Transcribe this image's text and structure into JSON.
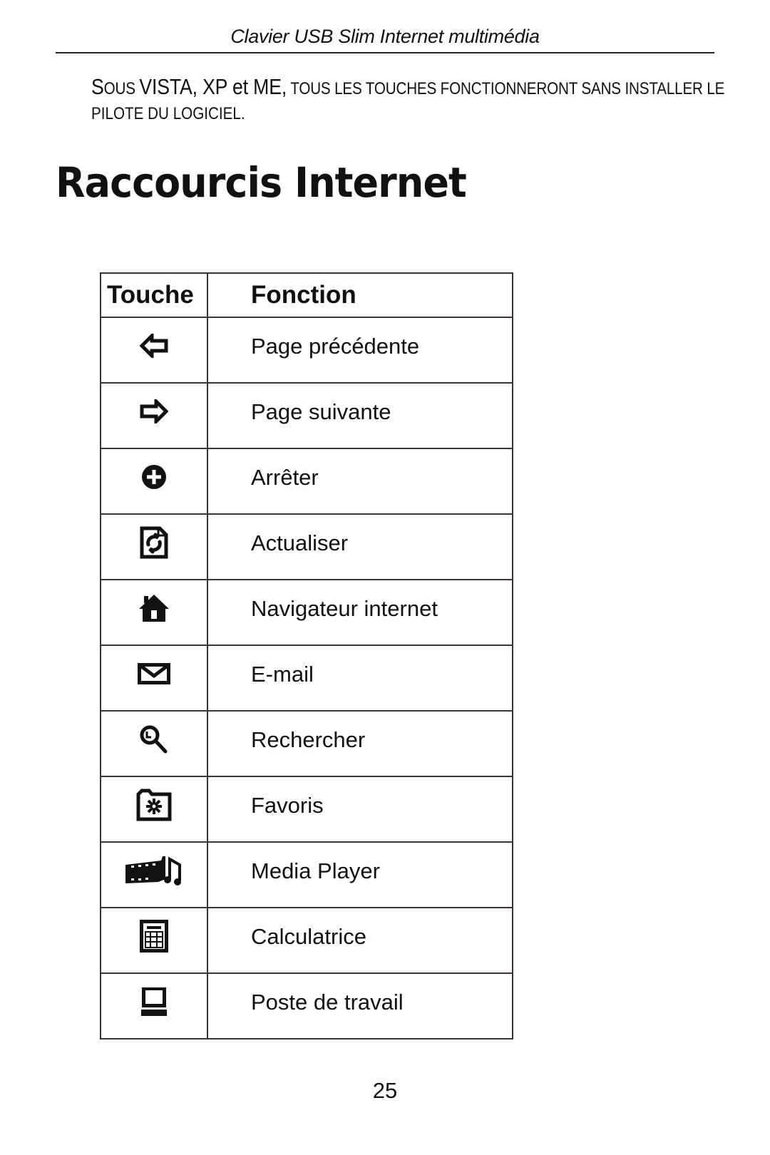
{
  "header": {
    "running_title": "Clavier USB Slim Internet multimédia"
  },
  "note": {
    "lead_1": "S",
    "lead_1_rest": "OUS",
    "lead_2": "VISTA, XP et ME,",
    "line1_rest": "TOUS LES TOUCHES FONCTIONNERONT SANS INSTALLER LE",
    "line2": "PILOTE DU LOGICIEL."
  },
  "section": {
    "title": "Raccourcis Internet"
  },
  "table": {
    "headers": {
      "key": "Touche",
      "function": "Fonction"
    },
    "rows": [
      {
        "icon": "back-arrow-icon",
        "function": "Page précédente"
      },
      {
        "icon": "forward-arrow-icon",
        "function": "Page suivante"
      },
      {
        "icon": "stop-icon",
        "function": "Arrêter"
      },
      {
        "icon": "refresh-icon",
        "function": "Actualiser"
      },
      {
        "icon": "home-icon",
        "function": "Navigateur internet"
      },
      {
        "icon": "mail-icon",
        "function": "E-mail"
      },
      {
        "icon": "search-icon",
        "function": "Rechercher"
      },
      {
        "icon": "favorites-folder-icon",
        "function": "Favoris"
      },
      {
        "icon": "media-player-icon",
        "function": "Media Player"
      },
      {
        "icon": "calculator-icon",
        "function": "Calculatrice"
      },
      {
        "icon": "my-computer-icon",
        "function": "Poste de travail"
      }
    ]
  },
  "footer": {
    "page_number": "25"
  }
}
